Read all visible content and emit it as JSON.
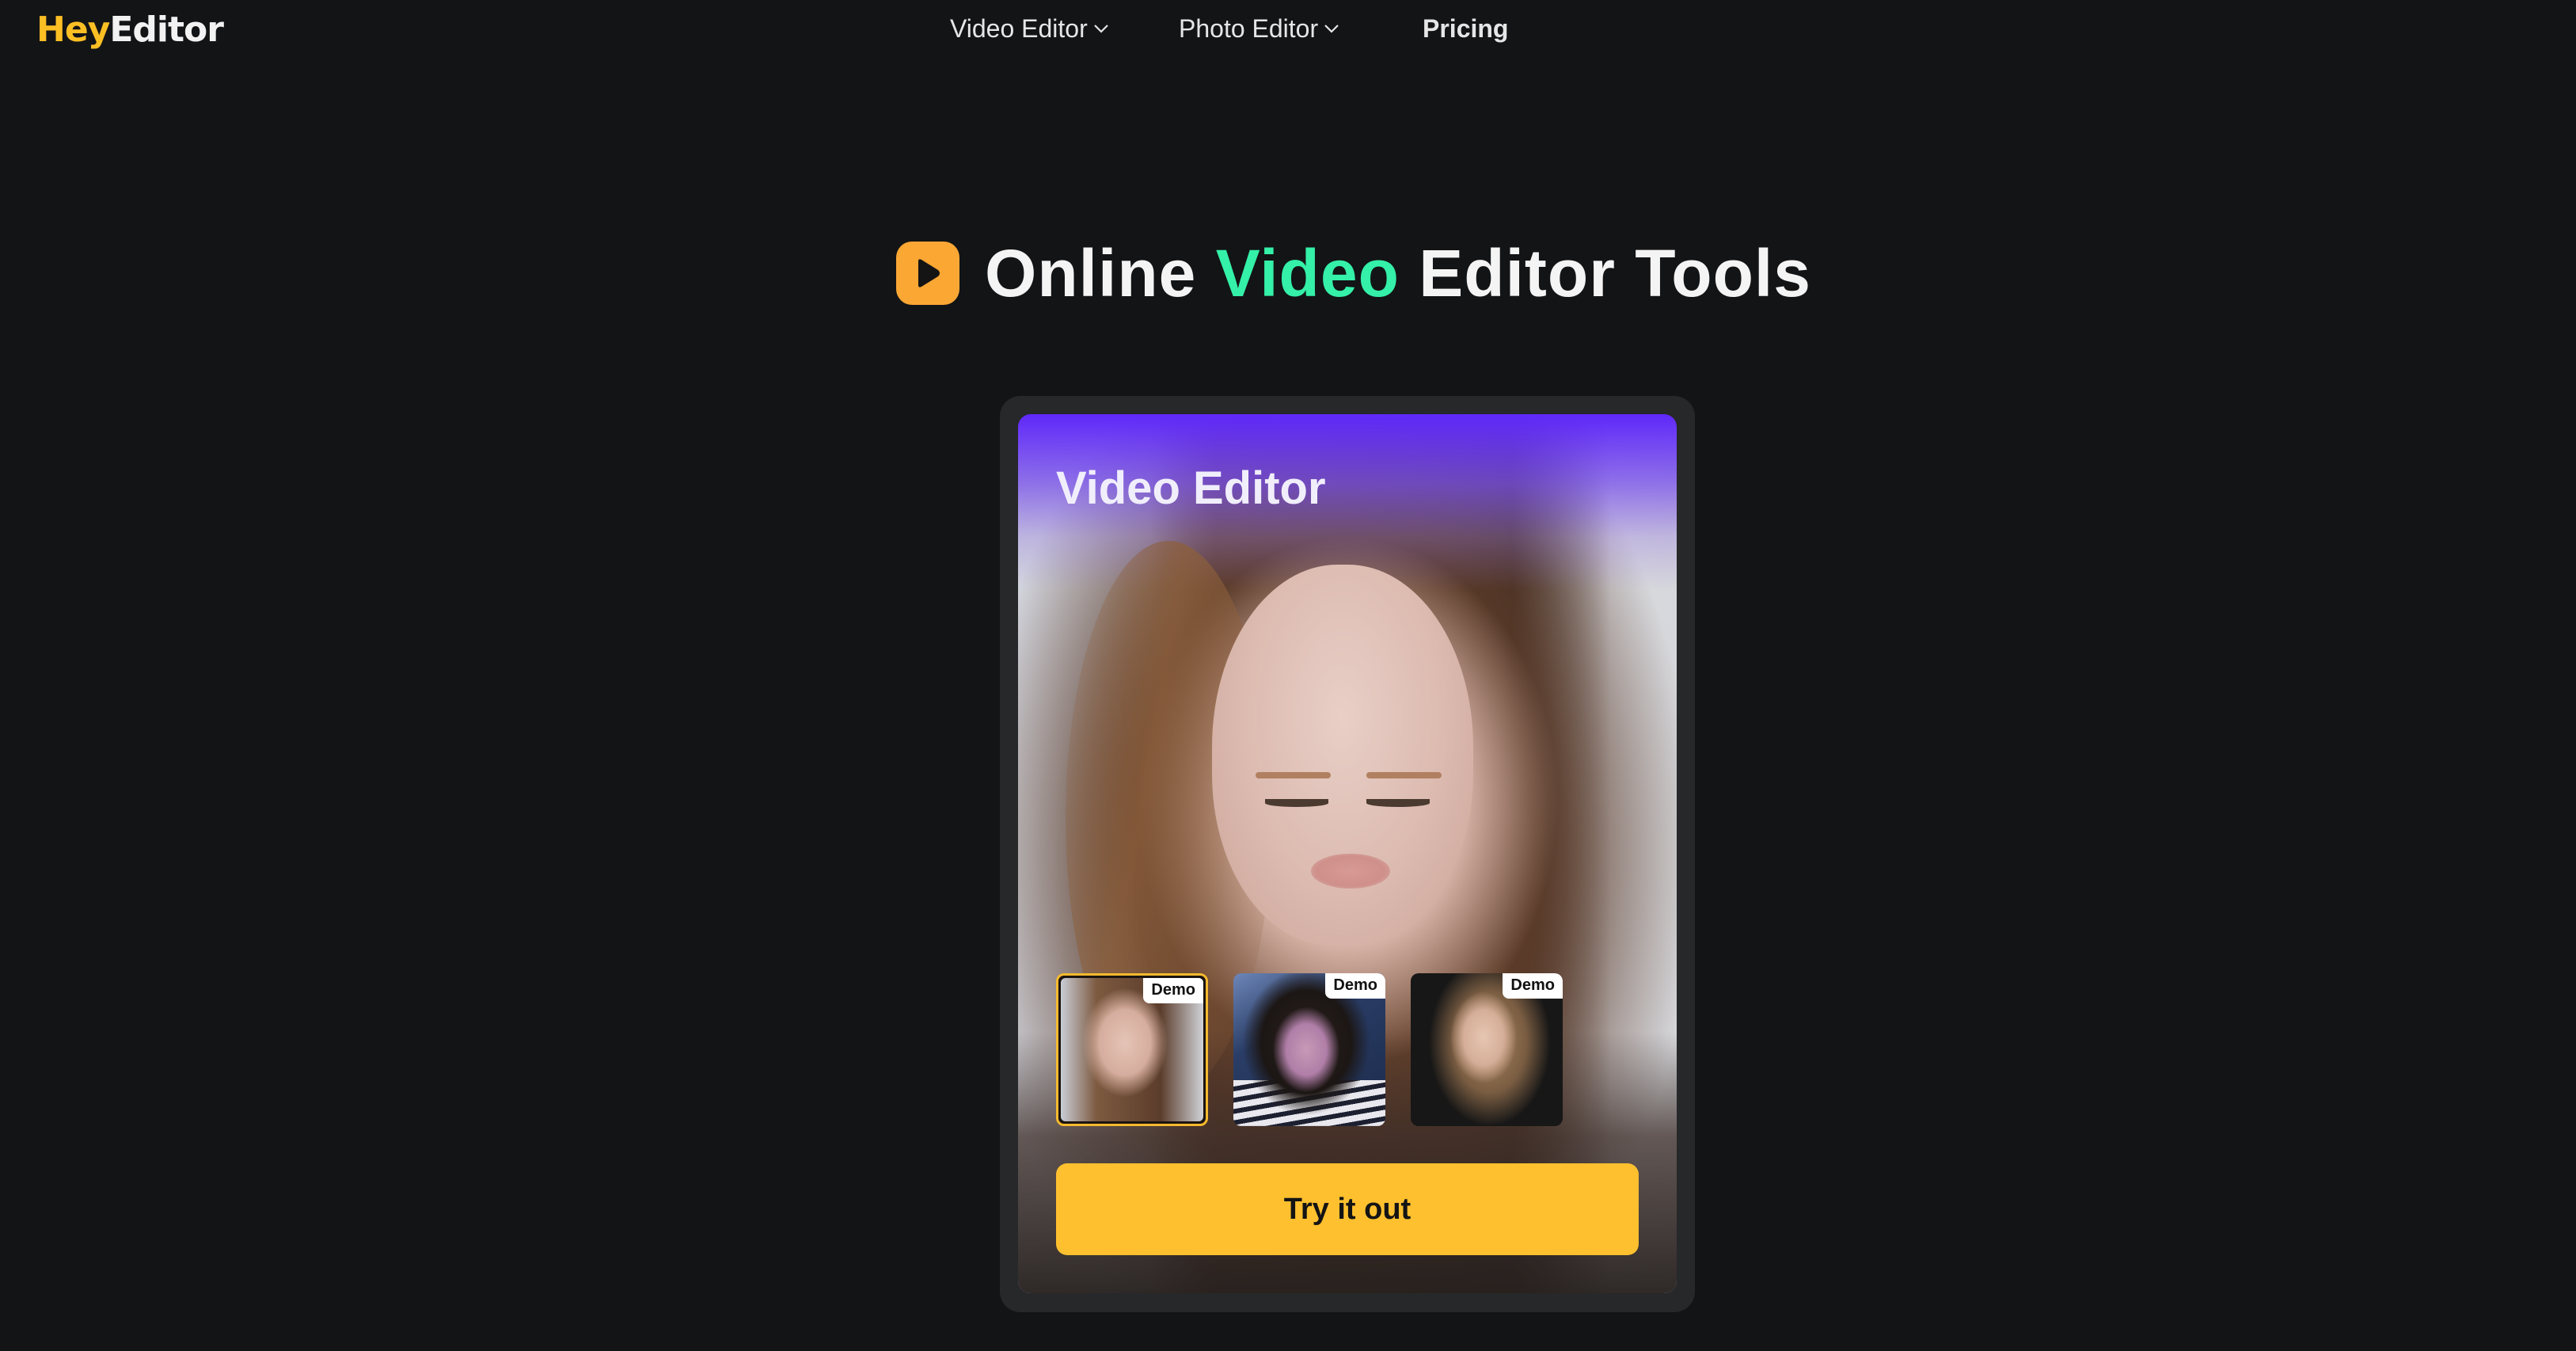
{
  "brand": {
    "name_part1": "Hey",
    "name_part2": "Editor",
    "accent_color": "#fbbf24"
  },
  "nav": {
    "items": [
      {
        "label": "Video Editor",
        "has_dropdown": true,
        "icon": "chevron-down-icon"
      },
      {
        "label": "Photo Editor",
        "has_dropdown": true,
        "icon": "chevron-down-icon"
      },
      {
        "label": "Pricing",
        "has_dropdown": false
      }
    ]
  },
  "hero": {
    "icon": "play-icon",
    "title_part1": "Online ",
    "title_accent": "Video",
    "title_part2": " Editor Tools",
    "accent_color": "#34f0a8",
    "icon_color": "#fba734"
  },
  "card": {
    "title": "Video Editor",
    "preview_image": "woman-with-long-hair-portrait",
    "thumbnails": [
      {
        "badge": "Demo",
        "image": "woman-long-brown-hair",
        "selected": true
      },
      {
        "badge": "Demo",
        "image": "man-curly-hair-striped-shirt",
        "selected": false
      },
      {
        "badge": "Demo",
        "image": "woman-blonde-hair-dark-background",
        "selected": false
      }
    ],
    "cta_label": "Try it out",
    "cta_color": "#fec02e"
  }
}
